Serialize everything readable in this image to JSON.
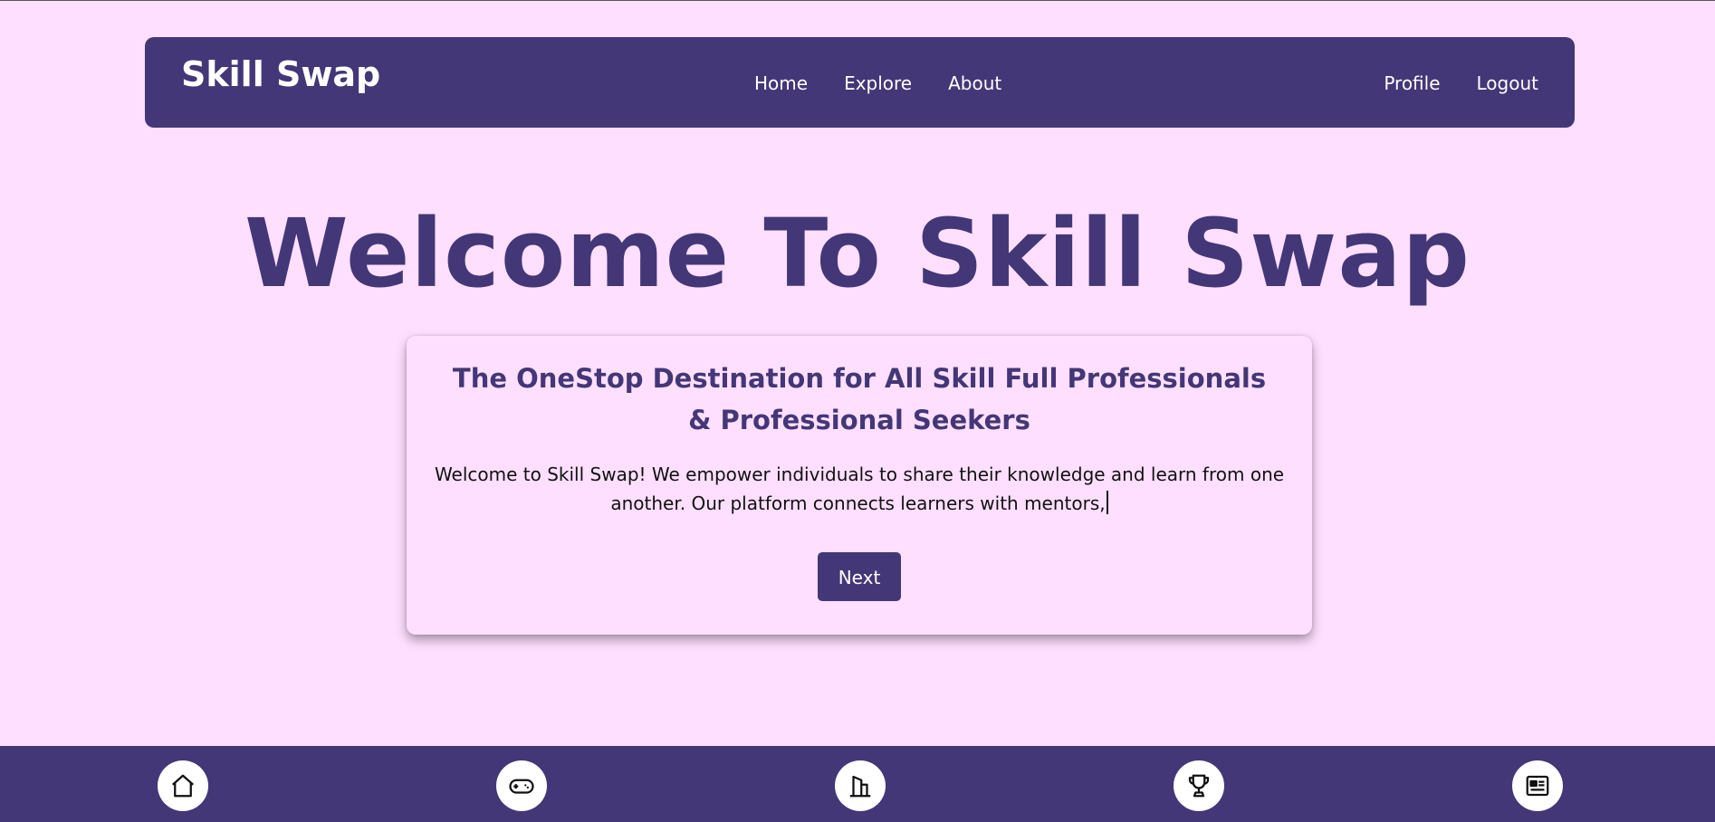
{
  "navbar": {
    "brand": "Skill Swap",
    "links_center": [
      "Home",
      "Explore",
      "About"
    ],
    "links_right": [
      "Profile",
      "Logout"
    ]
  },
  "hero": {
    "title": "Welcome To Skill Swap"
  },
  "card": {
    "heading": "The OneStop Destination for All Skill Full Professionals & Professional Seekers",
    "text": "Welcome to Skill Swap! We empower individuals to share their knowledge and learn from one another. Our platform connects learners with mentors,",
    "button_label": "Next"
  },
  "bottom_nav": {
    "icons": [
      "home-icon",
      "gamepad-icon",
      "building-icon",
      "trophy-icon",
      "news-icon"
    ]
  },
  "colors": {
    "background": "#ffdfff",
    "primary": "#433777",
    "white": "#ffffff"
  }
}
